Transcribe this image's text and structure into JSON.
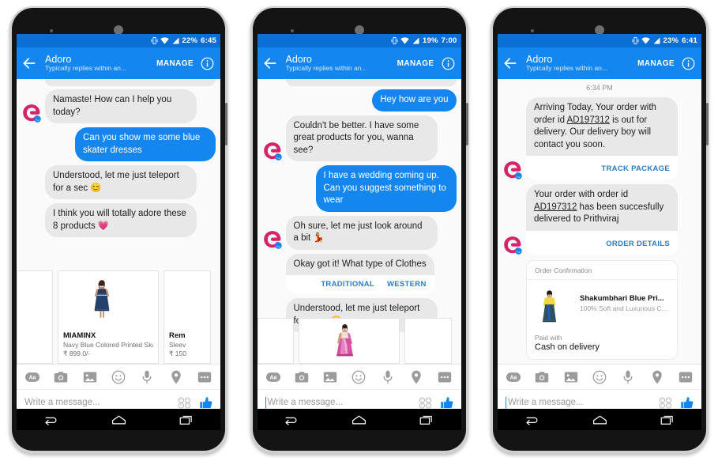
{
  "app": {
    "bot_name": "Adoro",
    "bot_subtitle": "Typically replies within an...",
    "manage_label": "MANAGE",
    "composer_placeholder": "Write a message..."
  },
  "phones": [
    {
      "status": {
        "battery": "22%",
        "time": "6:45"
      },
      "messages": [
        {
          "side": "in",
          "text": "Namaste! How can I help you today?",
          "avatar": true
        },
        {
          "side": "out",
          "text": "Can you show me some blue skater dresses"
        },
        {
          "side": "in",
          "text": "Understood, let me just teleport for a sec 😊",
          "avatar": false
        },
        {
          "side": "in",
          "text": "I think you will totally adore these 8 products 💗",
          "avatar": false
        }
      ],
      "carousel": [
        {
          "partial": "left",
          "title": "",
          "desc": "",
          "price": ""
        },
        {
          "partial": "none",
          "title": "MIAMINX",
          "desc": "Navy Blue Colored Printed Skater Dr",
          "price": "₹ 899.0/-"
        },
        {
          "partial": "right",
          "title": "Rem",
          "desc": "Sleev",
          "price": "₹ 150"
        }
      ]
    },
    {
      "status": {
        "battery": "19%",
        "time": "7:00"
      },
      "messages": [
        {
          "side": "out",
          "text": "Hey how are you"
        },
        {
          "side": "in",
          "text": "Couldn't be better. I have some great products for you, wanna see?",
          "avatar": true
        },
        {
          "side": "out",
          "text": "I have a wedding coming up. Can you suggest something to wear"
        },
        {
          "side": "in",
          "text": "Oh sure, let me just look around a bit 💃",
          "avatar": true
        },
        {
          "side": "in",
          "text": "Okay got it! What type of Clothes",
          "avatar": false,
          "quick_replies": [
            "TRADITIONAL",
            "WESTERN"
          ]
        },
        {
          "side": "in",
          "text": "Understood, let me just teleport for a sec 😊",
          "avatar": false
        }
      ],
      "carousel": [
        {
          "partial": "left"
        },
        {
          "partial": "none"
        },
        {
          "partial": "right"
        }
      ]
    },
    {
      "status": {
        "battery": "23%",
        "time": "6:41"
      },
      "timestamp": "6:34 PM",
      "messages": [
        {
          "side": "in",
          "text": "Arriving Today, Your order with order id AD197312 is out for delivery. Our delivery boy will contact you soon.",
          "link_text": "AD197312",
          "action": "TRACK PACKAGE",
          "avatar": true
        },
        {
          "side": "in",
          "text": "Your order with order id AD197312 has been succesfully delivered to Prithviraj",
          "link_text": "AD197312",
          "action": "ORDER DETAILS",
          "avatar": true
        }
      ],
      "order_card": {
        "header": "Order Confirmation",
        "title": "Shakumbhari Blue Pri...",
        "subtitle": "100% Soft and Luxurious C...",
        "paid_label": "Paid with",
        "paid_value": "Cash on delivery"
      }
    }
  ],
  "composer_tools": [
    "text-format-icon",
    "camera-icon",
    "gallery-icon",
    "emoji-icon",
    "microphone-icon",
    "location-icon",
    "more-icon"
  ],
  "nav": [
    "back-icon",
    "home-icon",
    "recents-icon"
  ],
  "colors": {
    "header_blue": "#1486f0",
    "statusbar_blue": "#0b6fd6",
    "outgoing_bubble": "#1486f0",
    "incoming_bubble": "#e8e8e8",
    "link_blue": "#2c7cc4",
    "brand_pink": "#d6236a"
  }
}
